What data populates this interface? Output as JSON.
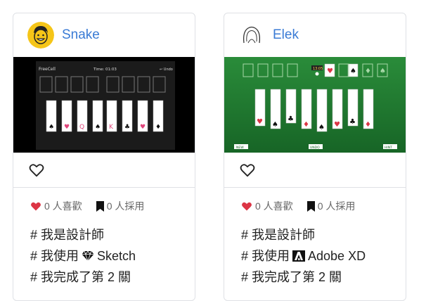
{
  "cards": [
    {
      "author": "Snake",
      "avatar_icon": "smiling-face-avatar",
      "game": {
        "title": "FreeCell",
        "time_label": "Time: 01:03",
        "undo_label": "↩ Undo"
      },
      "likes": "0 人喜歡",
      "adopts": "0 人採用",
      "tags": [
        {
          "prefix": "# 我是設計師",
          "tool_icon": "",
          "tool": ""
        },
        {
          "prefix": "# 我使用",
          "tool_icon": "sketch-diamond-icon",
          "tool": "Sketch"
        },
        {
          "prefix": "# 我完成了第 2 關",
          "tool_icon": "",
          "tool": ""
        }
      ]
    },
    {
      "author": "Elek",
      "avatar_icon": "line-sketch-avatar",
      "game": {
        "score_label": "13:05",
        "new_label": "NEW",
        "undo_label": "UNDO",
        "hint_label": "HINT"
      },
      "likes": "0 人喜歡",
      "adopts": "0 人採用",
      "tags": [
        {
          "prefix": "# 我是設計師",
          "tool_icon": "",
          "tool": ""
        },
        {
          "prefix": "# 我使用",
          "tool_icon": "adobe-xd-icon",
          "tool": "Adobe XD"
        },
        {
          "prefix": "# 我完成了第 2 關",
          "tool_icon": "",
          "tool": ""
        }
      ]
    }
  ],
  "colors": {
    "like_heart": "#dc3545",
    "link_blue": "#3a7bd5",
    "felt_green": "#1e7a2e",
    "dark_board": "#1b1b1b"
  }
}
